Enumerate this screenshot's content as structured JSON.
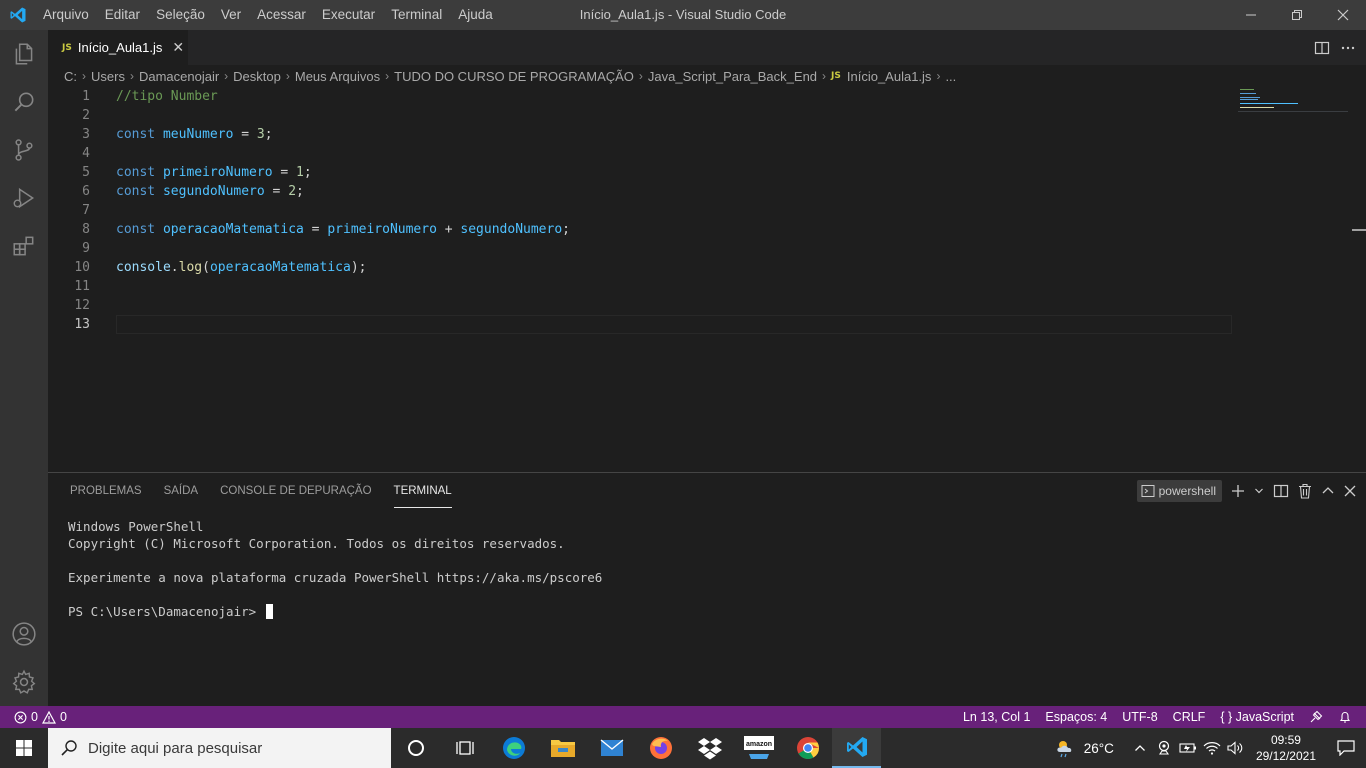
{
  "titlebar": {
    "menu": [
      "Arquivo",
      "Editar",
      "Seleção",
      "Ver",
      "Acessar",
      "Executar",
      "Terminal",
      "Ajuda"
    ],
    "window_title": "Início_Aula1.js - Visual Studio Code"
  },
  "tab": {
    "badge": "JS",
    "label": "Início_Aula1.js",
    "close": "✕"
  },
  "breadcrumb": {
    "parts": [
      "C:",
      "Users",
      "Damacenojair",
      "Desktop",
      "Meus Arquivos",
      "TUDO DO CURSO DE PROGRAMAÇÃO",
      "Java_Script_Para_Back_End"
    ],
    "file_badge": "JS",
    "file": "Início_Aula1.js",
    "ellipsis": "..."
  },
  "editor": {
    "line_numbers": [
      "1",
      "2",
      "3",
      "4",
      "5",
      "6",
      "7",
      "8",
      "9",
      "10",
      "11",
      "12",
      "13"
    ],
    "active_line": "13",
    "code": {
      "l1_comment": "//tipo Number",
      "l3_kw": "const",
      "l3_var": "meuNumero",
      "l3_op": " = ",
      "l3_num": "3",
      "l3_end": ";",
      "l5_kw": "const",
      "l5_var": "primeiroNumero",
      "l5_op": " = ",
      "l5_num": "1",
      "l5_end": ";",
      "l6_kw": "const",
      "l6_var": "segundoNumero",
      "l6_op": " = ",
      "l6_num": "2",
      "l6_end": ";",
      "l8_kw": "const",
      "l8_var": "operacaoMatematica",
      "l8_op": " = ",
      "l8_a": "primeiroNumero",
      "l8_plus": " + ",
      "l8_b": "segundoNumero",
      "l8_end": ";",
      "l10_obj": "console",
      "l10_dot": ".",
      "l10_fn": "log",
      "l10_open": "(",
      "l10_arg": "operacaoMatematica",
      "l10_close": ");"
    }
  },
  "panel": {
    "tabs": [
      "PROBLEMAS",
      "SAÍDA",
      "CONSOLE DE DEPURAÇÃO",
      "TERMINAL"
    ],
    "active_tab": "TERMINAL",
    "shell": "powershell",
    "terminal_lines": [
      "Windows PowerShell",
      "Copyright (C) Microsoft Corporation. Todos os direitos reservados.",
      "",
      "Experimente a nova plataforma cruzada PowerShell https://aka.ms/pscore6",
      ""
    ],
    "prompt": "PS C:\\Users\\Damacenojair> "
  },
  "statusbar": {
    "errors": "0",
    "warnings": "0",
    "position": "Ln 13, Col 1",
    "spaces": "Espaços: 4",
    "encoding": "UTF-8",
    "eol": "CRLF",
    "language_icon": "{ }",
    "language": "JavaScript"
  },
  "taskbar": {
    "search_placeholder": "Digite aqui para pesquisar",
    "weather": "26°C",
    "time": "09:59",
    "date": "29/12/2021",
    "amazon_label": "amazon"
  },
  "colors": {
    "statusbar": "#68217a",
    "titlebar": "#3c3c3c",
    "activitybar": "#333333",
    "editor_bg": "#1e1e1e"
  }
}
